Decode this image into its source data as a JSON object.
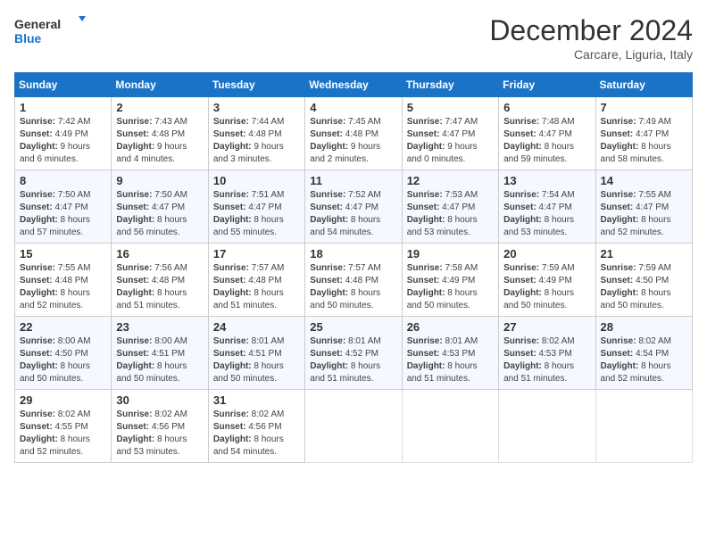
{
  "header": {
    "logo_line1": "General",
    "logo_line2": "Blue",
    "month": "December 2024",
    "location": "Carcare, Liguria, Italy"
  },
  "weekdays": [
    "Sunday",
    "Monday",
    "Tuesday",
    "Wednesday",
    "Thursday",
    "Friday",
    "Saturday"
  ],
  "weeks": [
    [
      {
        "day": "1",
        "sr": "7:42 AM",
        "ss": "4:49 PM",
        "dl": "9 hours and 6 minutes."
      },
      {
        "day": "2",
        "sr": "7:43 AM",
        "ss": "4:48 PM",
        "dl": "9 hours and 4 minutes."
      },
      {
        "day": "3",
        "sr": "7:44 AM",
        "ss": "4:48 PM",
        "dl": "9 hours and 3 minutes."
      },
      {
        "day": "4",
        "sr": "7:45 AM",
        "ss": "4:48 PM",
        "dl": "9 hours and 2 minutes."
      },
      {
        "day": "5",
        "sr": "7:47 AM",
        "ss": "4:47 PM",
        "dl": "9 hours and 0 minutes."
      },
      {
        "day": "6",
        "sr": "7:48 AM",
        "ss": "4:47 PM",
        "dl": "8 hours and 59 minutes."
      },
      {
        "day": "7",
        "sr": "7:49 AM",
        "ss": "4:47 PM",
        "dl": "8 hours and 58 minutes."
      }
    ],
    [
      {
        "day": "8",
        "sr": "7:50 AM",
        "ss": "4:47 PM",
        "dl": "8 hours and 57 minutes."
      },
      {
        "day": "9",
        "sr": "7:50 AM",
        "ss": "4:47 PM",
        "dl": "8 hours and 56 minutes."
      },
      {
        "day": "10",
        "sr": "7:51 AM",
        "ss": "4:47 PM",
        "dl": "8 hours and 55 minutes."
      },
      {
        "day": "11",
        "sr": "7:52 AM",
        "ss": "4:47 PM",
        "dl": "8 hours and 54 minutes."
      },
      {
        "day": "12",
        "sr": "7:53 AM",
        "ss": "4:47 PM",
        "dl": "8 hours and 53 minutes."
      },
      {
        "day": "13",
        "sr": "7:54 AM",
        "ss": "4:47 PM",
        "dl": "8 hours and 53 minutes."
      },
      {
        "day": "14",
        "sr": "7:55 AM",
        "ss": "4:47 PM",
        "dl": "8 hours and 52 minutes."
      }
    ],
    [
      {
        "day": "15",
        "sr": "7:55 AM",
        "ss": "4:48 PM",
        "dl": "8 hours and 52 minutes."
      },
      {
        "day": "16",
        "sr": "7:56 AM",
        "ss": "4:48 PM",
        "dl": "8 hours and 51 minutes."
      },
      {
        "day": "17",
        "sr": "7:57 AM",
        "ss": "4:48 PM",
        "dl": "8 hours and 51 minutes."
      },
      {
        "day": "18",
        "sr": "7:57 AM",
        "ss": "4:48 PM",
        "dl": "8 hours and 50 minutes."
      },
      {
        "day": "19",
        "sr": "7:58 AM",
        "ss": "4:49 PM",
        "dl": "8 hours and 50 minutes."
      },
      {
        "day": "20",
        "sr": "7:59 AM",
        "ss": "4:49 PM",
        "dl": "8 hours and 50 minutes."
      },
      {
        "day": "21",
        "sr": "7:59 AM",
        "ss": "4:50 PM",
        "dl": "8 hours and 50 minutes."
      }
    ],
    [
      {
        "day": "22",
        "sr": "8:00 AM",
        "ss": "4:50 PM",
        "dl": "8 hours and 50 minutes."
      },
      {
        "day": "23",
        "sr": "8:00 AM",
        "ss": "4:51 PM",
        "dl": "8 hours and 50 minutes."
      },
      {
        "day": "24",
        "sr": "8:01 AM",
        "ss": "4:51 PM",
        "dl": "8 hours and 50 minutes."
      },
      {
        "day": "25",
        "sr": "8:01 AM",
        "ss": "4:52 PM",
        "dl": "8 hours and 51 minutes."
      },
      {
        "day": "26",
        "sr": "8:01 AM",
        "ss": "4:53 PM",
        "dl": "8 hours and 51 minutes."
      },
      {
        "day": "27",
        "sr": "8:02 AM",
        "ss": "4:53 PM",
        "dl": "8 hours and 51 minutes."
      },
      {
        "day": "28",
        "sr": "8:02 AM",
        "ss": "4:54 PM",
        "dl": "8 hours and 52 minutes."
      }
    ],
    [
      {
        "day": "29",
        "sr": "8:02 AM",
        "ss": "4:55 PM",
        "dl": "8 hours and 52 minutes."
      },
      {
        "day": "30",
        "sr": "8:02 AM",
        "ss": "4:56 PM",
        "dl": "8 hours and 53 minutes."
      },
      {
        "day": "31",
        "sr": "8:02 AM",
        "ss": "4:56 PM",
        "dl": "8 hours and 54 minutes."
      },
      null,
      null,
      null,
      null
    ]
  ],
  "labels": {
    "sunrise": "Sunrise: ",
    "sunset": "Sunset: ",
    "daylight": "Daylight: "
  }
}
